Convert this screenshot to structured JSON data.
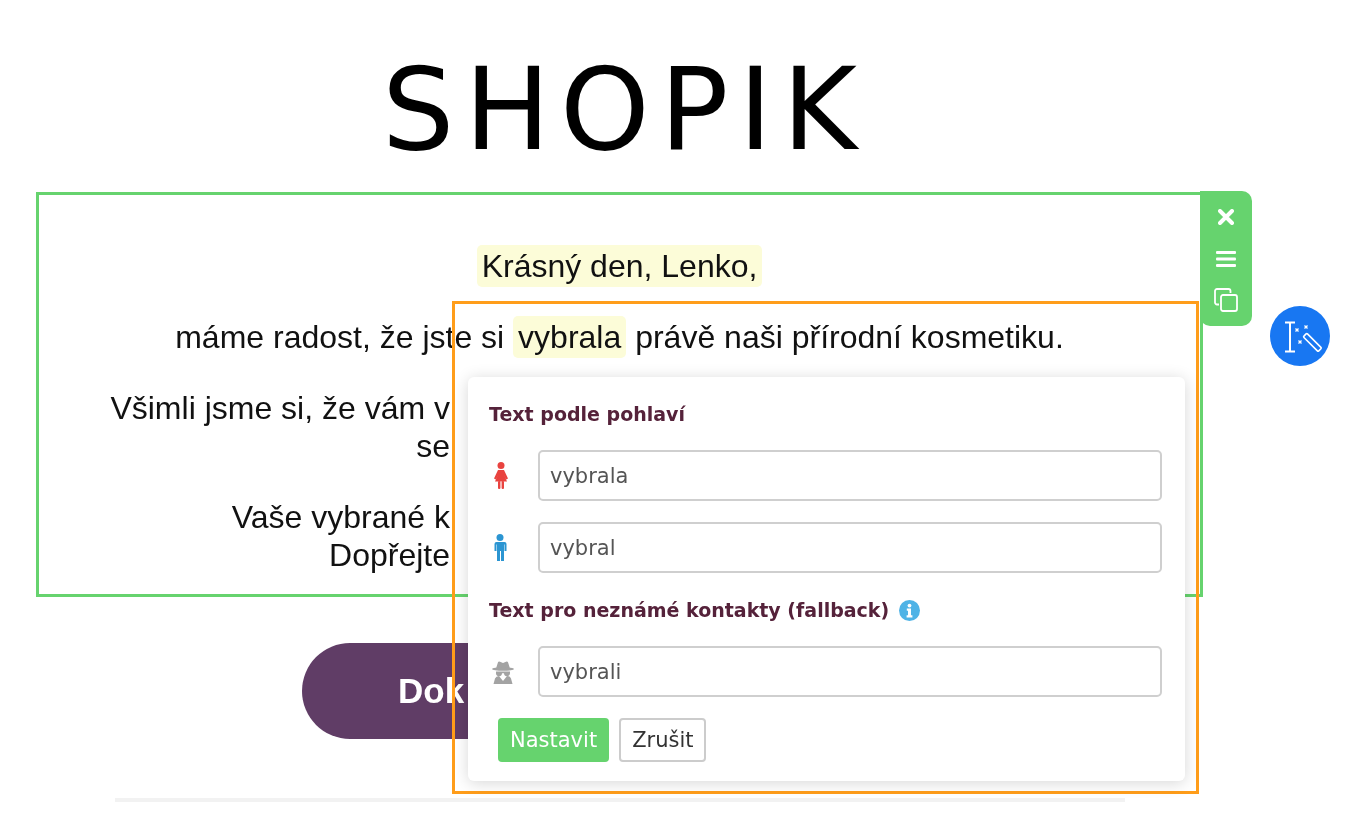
{
  "logo": {
    "text": "SHOPIK"
  },
  "content_block": {
    "paragraphs": [
      {
        "kind": "full",
        "segments": [
          {
            "text": "Krásný den, Lenko,",
            "highlighted": true
          }
        ]
      },
      {
        "kind": "full",
        "segments": [
          {
            "text": "máme radost, že jste si ",
            "highlighted": false
          },
          {
            "text": "vybrala",
            "highlighted": true
          },
          {
            "text": " právě naši přírodní kosmetiku.",
            "highlighted": false
          }
        ]
      },
      {
        "kind": "cut",
        "lines": [
          "Všimli jsme si, že vám v",
          "se"
        ]
      },
      {
        "kind": "cut",
        "lines": [
          "Vaše vybrané k",
          "Dopřejte"
        ]
      }
    ]
  },
  "cta_button": {
    "label": "Dok"
  },
  "gender_popup": {
    "sections": [
      {
        "title": "Text podle pohlaví",
        "info": false,
        "fields": [
          {
            "kind": "female",
            "value": "vybrala"
          },
          {
            "kind": "male",
            "value": "vybral"
          }
        ]
      },
      {
        "title": "Text pro neznámé kontakty (fallback)",
        "info": true,
        "fields": [
          {
            "kind": "unknown",
            "value": "vybrali"
          }
        ]
      }
    ],
    "buttons": [
      {
        "kind": "primary",
        "label": "Nastavit"
      },
      {
        "kind": "secondary",
        "label": "Zrušit"
      }
    ]
  }
}
